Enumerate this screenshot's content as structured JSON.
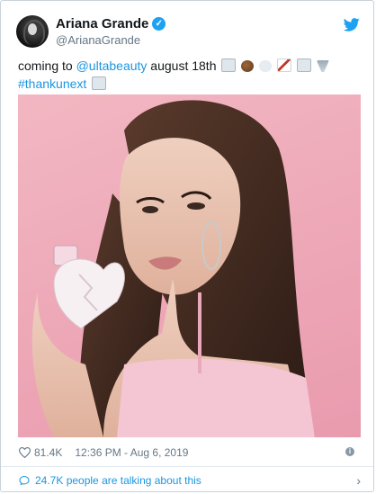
{
  "tweet": {
    "author_name": "Ariana Grande",
    "verified_mark": "✓",
    "handle": "@ArianaGrande",
    "text_prefix": "coming to ",
    "mention": "@ultabeauty",
    "text_suffix": " august 18th",
    "hashtag": "#thankunext",
    "emojis": [
      "envelope-icon",
      "coconut-icon",
      "cloud-icon",
      "bow-arrow-icon",
      "envelope-icon",
      "tornado-icon",
      "envelope-icon"
    ]
  },
  "footer": {
    "likes": "81.4K",
    "timestamp": "12:36 PM - Aug 6, 2019",
    "info_mark": "i"
  },
  "conversation": {
    "label": "24.7K people are talking about this",
    "chevron": "›"
  },
  "colors": {
    "link": "#1b95e0",
    "verified": "#1da1f2",
    "muted": "#657786",
    "photo_background": "#eeaab9"
  }
}
